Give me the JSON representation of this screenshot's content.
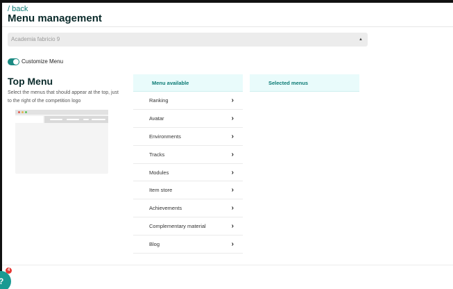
{
  "header": {
    "back_label": "/ back",
    "title": "Menu management"
  },
  "select": {
    "value": "Academia fabricio 9",
    "arrow_icon": "select-arrows-icon"
  },
  "toggle": {
    "label": "Customize Menu",
    "on": true,
    "accent": "#1a8a82"
  },
  "section": {
    "title": "Top Menu",
    "description": "Select the menus that should appear at the top, just to the right of the competition logo"
  },
  "available": {
    "header": "Menu available",
    "items": [
      {
        "label": "Ranking"
      },
      {
        "label": "Avatar"
      },
      {
        "label": "Environments"
      },
      {
        "label": "Tracks"
      },
      {
        "label": "Modules"
      },
      {
        "label": "Item store"
      },
      {
        "label": "Achievements"
      },
      {
        "label": "Complementary material"
      },
      {
        "label": "Blog"
      }
    ]
  },
  "selected": {
    "header": "Selected menus"
  },
  "chat": {
    "badge": "4",
    "icon": "chat-icon"
  }
}
